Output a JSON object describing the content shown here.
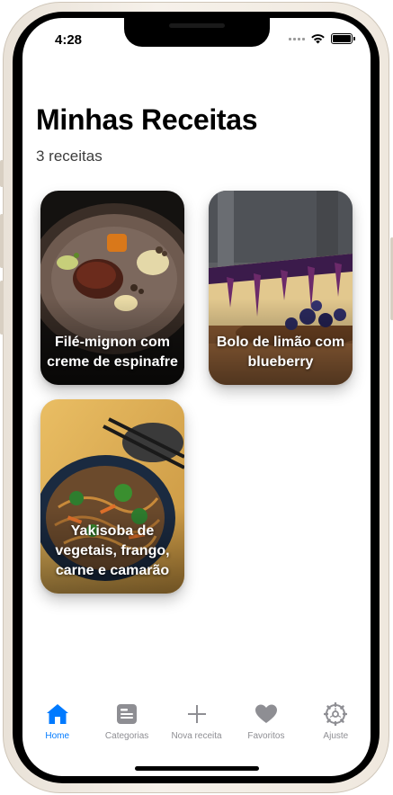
{
  "status_bar": {
    "time": "4:28"
  },
  "header": {
    "title": "Minhas Receitas",
    "count": "3 receitas"
  },
  "recipes": [
    {
      "title": "Filé-mignon com creme de espinafre"
    },
    {
      "title": "Bolo de limão com blueberry"
    },
    {
      "title": "Yakisoba de vegetais, frango, carne e camarão"
    }
  ],
  "tabbar": {
    "accent_color": "#007aff",
    "inactive_color": "#8e8e93",
    "tabs": [
      {
        "label": "Home",
        "icon": "house-icon",
        "active": true
      },
      {
        "label": "Categorias",
        "icon": "list-card-icon",
        "active": false
      },
      {
        "label": "Nova receita",
        "icon": "plus-icon",
        "active": false
      },
      {
        "label": "Favoritos",
        "icon": "heart-icon",
        "active": false
      },
      {
        "label": "Ajuste",
        "icon": "gear-icon",
        "active": false
      }
    ]
  }
}
